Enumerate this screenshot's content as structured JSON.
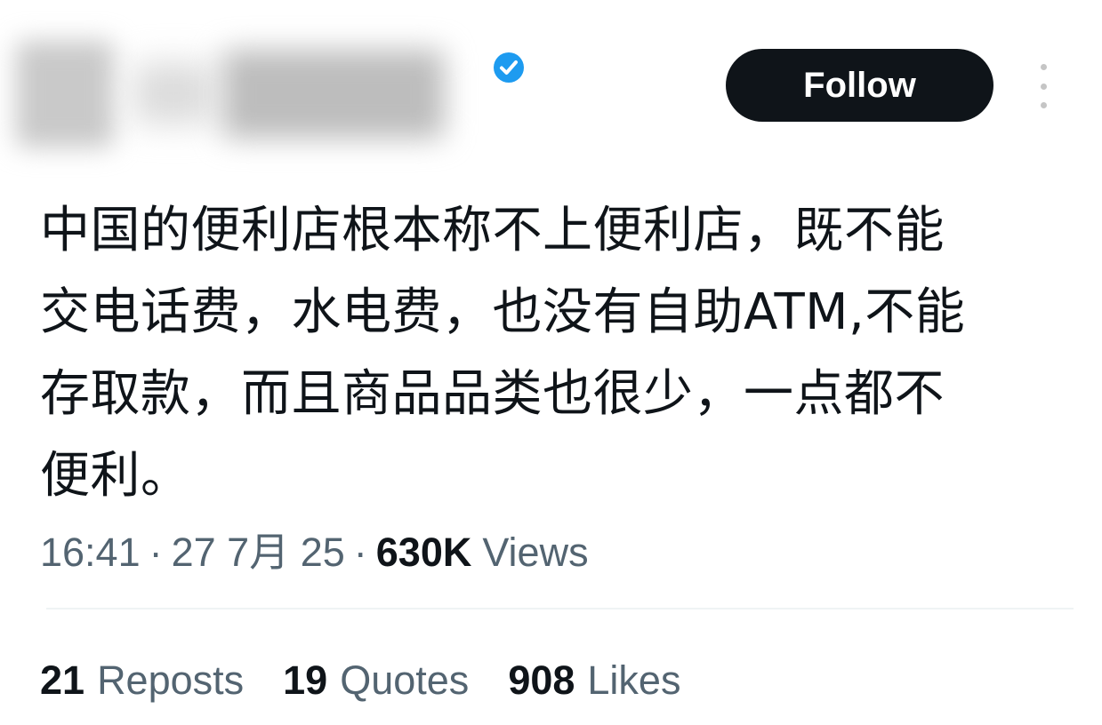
{
  "tweet": {
    "follow_label": "Follow",
    "text": "中国的便利店根本称不上便利店，既不能\n交电话费，水电费，也没有自助ATM,不能\n存取款，而且商品品类也很少，一点都不\n便利。",
    "time": "16:41",
    "date": "27 7月 25",
    "separator": "·",
    "views_count": "630K",
    "views_label": "Views"
  },
  "stats": {
    "reposts_count": "21",
    "reposts_label": "Reposts",
    "quotes_count": "19",
    "quotes_label": "Quotes",
    "likes_count": "908",
    "likes_label": "Likes"
  },
  "icons": {
    "verified": "verified-badge-icon",
    "more": "more-vertical-icon"
  },
  "colors": {
    "verified_blue": "#1d9bf0",
    "button_bg": "#0f1419",
    "secondary_text": "#536471"
  }
}
